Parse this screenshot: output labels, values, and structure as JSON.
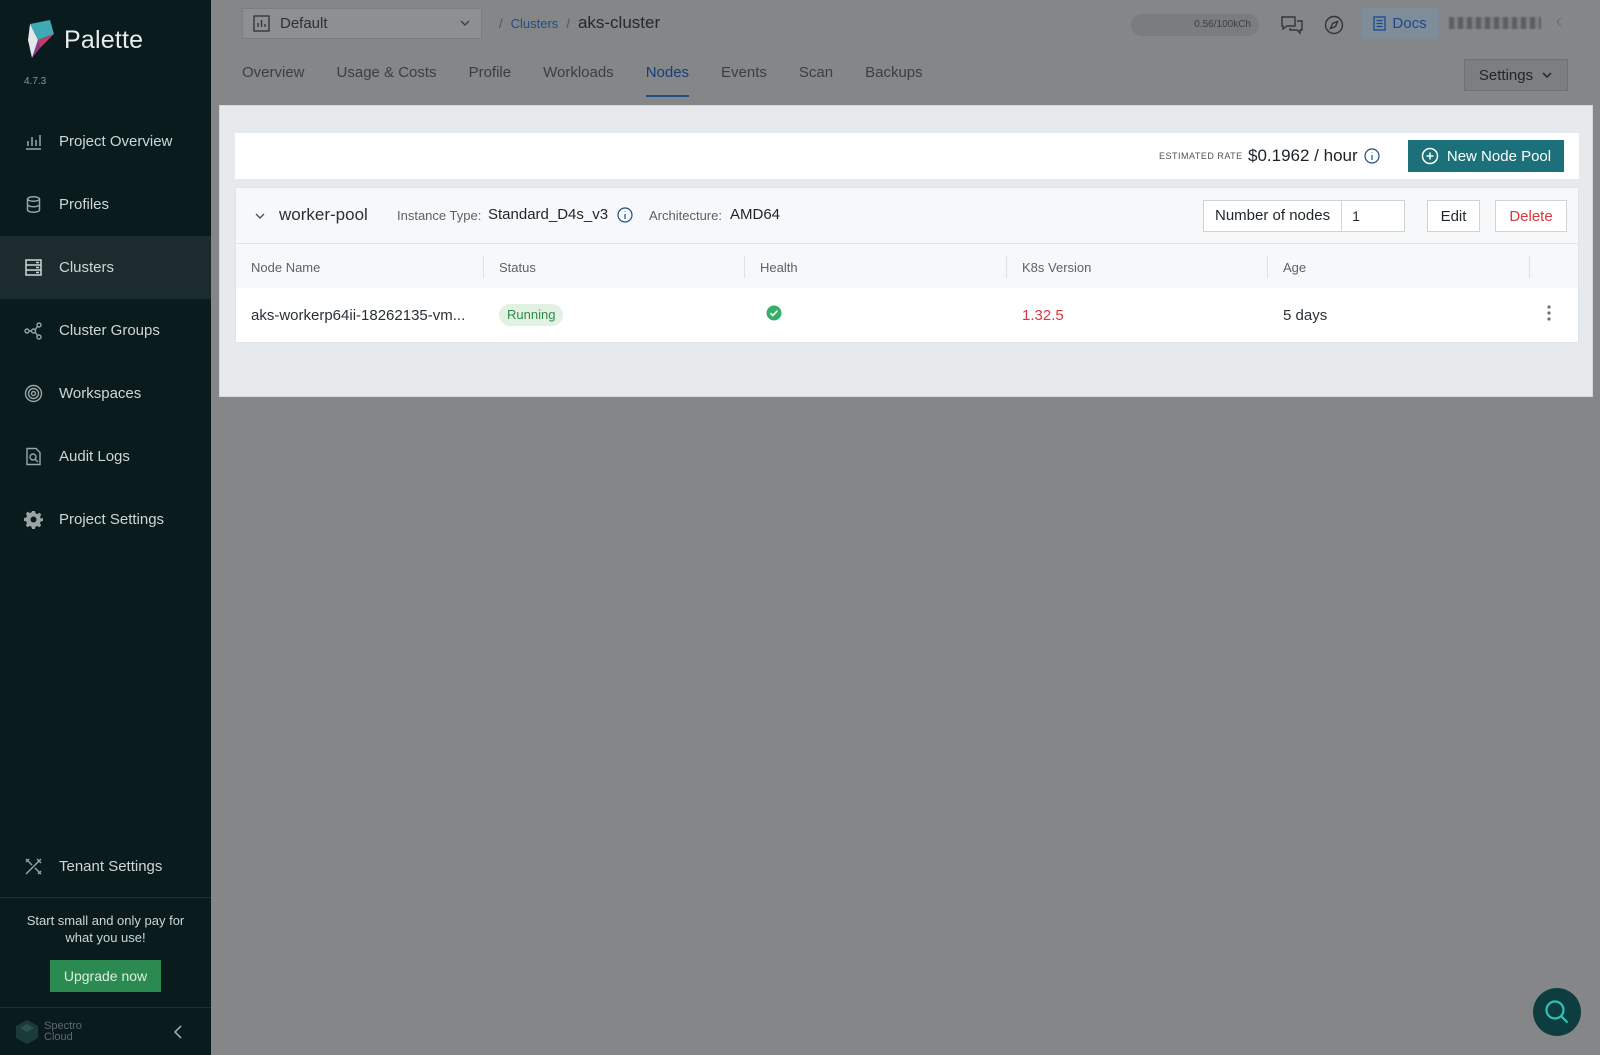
{
  "app": {
    "name": "Palette",
    "version": "4.7.3"
  },
  "sidebar": {
    "items": [
      {
        "label": "Project Overview",
        "icon": "chart-icon"
      },
      {
        "label": "Profiles",
        "icon": "database-icon"
      },
      {
        "label": "Clusters",
        "icon": "clusters-icon",
        "active": true
      },
      {
        "label": "Cluster Groups",
        "icon": "network-icon"
      },
      {
        "label": "Workspaces",
        "icon": "target-icon"
      },
      {
        "label": "Audit Logs",
        "icon": "search-document-icon"
      },
      {
        "label": "Project Settings",
        "icon": "gear-icon"
      }
    ],
    "tenant_settings": "Tenant Settings",
    "promo_text": "Start small and only pay for what you use!",
    "upgrade_label": "Upgrade now",
    "footer_brand_line1": "Spectro",
    "footer_brand_line2": "Cloud"
  },
  "header": {
    "project": "Default",
    "breadcrumb_link": "Clusters",
    "breadcrumb_current": "aks-cluster",
    "usage": "0.56/100kCh",
    "docs_label": "Docs"
  },
  "tabs": [
    {
      "label": "Overview"
    },
    {
      "label": "Usage & Costs"
    },
    {
      "label": "Profile"
    },
    {
      "label": "Workloads"
    },
    {
      "label": "Nodes",
      "active": true
    },
    {
      "label": "Events"
    },
    {
      "label": "Scan"
    },
    {
      "label": "Backups"
    }
  ],
  "settings_label": "Settings",
  "rate": {
    "label": "ESTIMATED RATE",
    "value": "$0.1962 / hour"
  },
  "new_pool_label": "New Node Pool",
  "pool": {
    "name": "worker-pool",
    "instance_type_label": "Instance Type:",
    "instance_type": "Standard_D4s_v3",
    "architecture_label": "Architecture:",
    "architecture": "AMD64",
    "nodes_label": "Number of nodes",
    "nodes_value": "1",
    "edit_label": "Edit",
    "delete_label": "Delete",
    "columns": [
      "Node Name",
      "Status",
      "Health",
      "K8s Version",
      "Age"
    ],
    "rows": [
      {
        "name": "aks-workerp64ii-18262135-vm...",
        "status": "Running",
        "health": "healthy",
        "k8s": "1.32.5",
        "age": "5 days"
      }
    ]
  },
  "colors": {
    "accent": "#1c7079",
    "link": "#1f4e86",
    "danger": "#d9363e",
    "success": "#2e8b47"
  }
}
